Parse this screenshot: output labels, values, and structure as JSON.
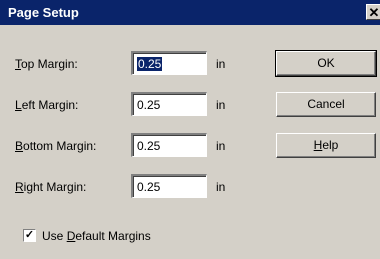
{
  "window": {
    "title": "Page Setup",
    "close_glyph": "✕"
  },
  "fields": [
    {
      "label_prefix": "",
      "label_accel": "T",
      "label_suffix": "op Margin:",
      "value": "0.25",
      "unit": "in"
    },
    {
      "label_prefix": "",
      "label_accel": "L",
      "label_suffix": "eft Margin:",
      "value": "0.25",
      "unit": "in"
    },
    {
      "label_prefix": "",
      "label_accel": "B",
      "label_suffix": "ottom Margin:",
      "value": "0.25",
      "unit": "in"
    },
    {
      "label_prefix": "",
      "label_accel": "R",
      "label_suffix": "ight Margin:",
      "value": "0.25",
      "unit": "in"
    }
  ],
  "buttons": {
    "ok": "OK",
    "cancel": "Cancel",
    "help_accel": "H",
    "help_rest": "elp"
  },
  "checkbox": {
    "checked": true,
    "mark": "✓",
    "label_prefix": "Use ",
    "label_accel": "D",
    "label_suffix": "efault Margins"
  },
  "colors": {
    "titlebar": "#0a246a",
    "dialog_bg": "#d4d0c8",
    "selection": "#0a246a"
  }
}
